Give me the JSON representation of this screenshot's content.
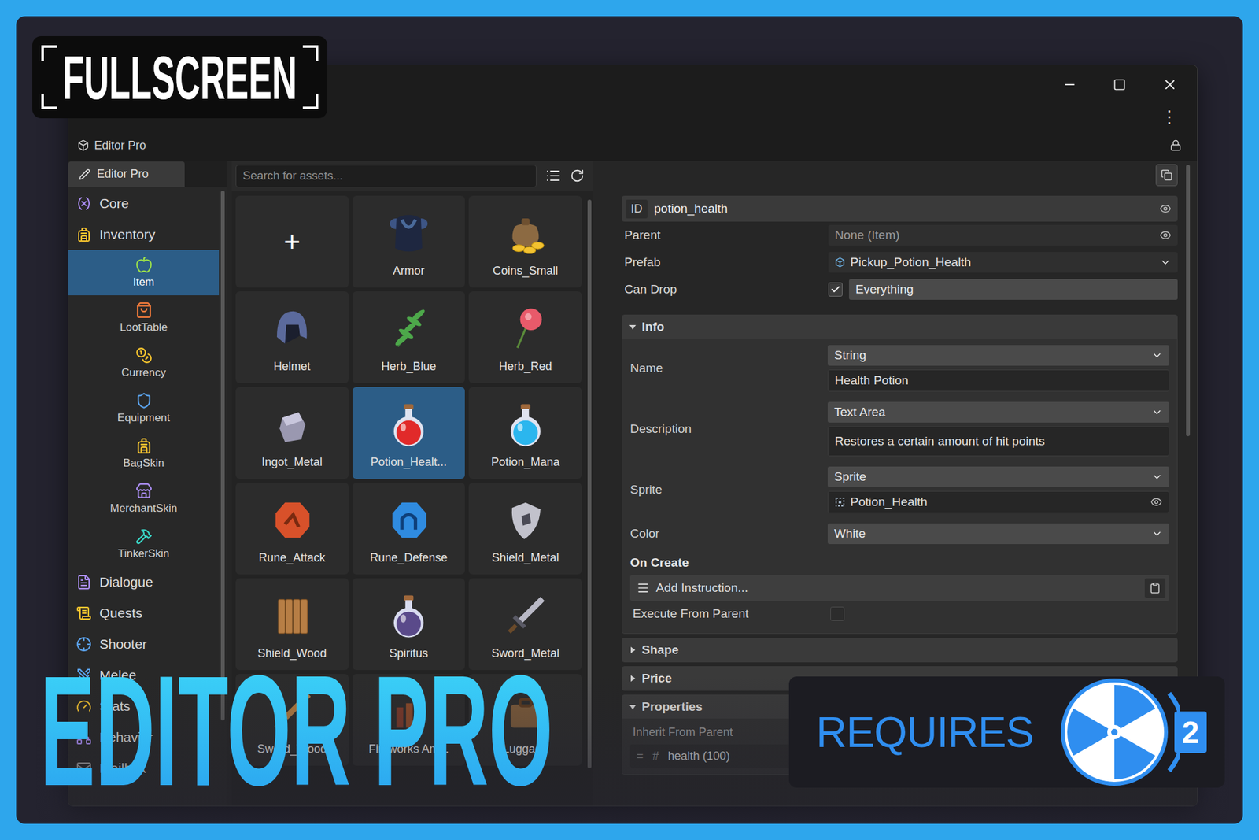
{
  "badge": {
    "text": "FULLSCREEN"
  },
  "window": {
    "title": "Editor Pro",
    "tab": "Editor Pro",
    "more": "⋮"
  },
  "sidebar": {
    "items": [
      {
        "label": "Core",
        "expanded": false,
        "children": []
      },
      {
        "label": "Inventory",
        "expanded": true,
        "children": [
          {
            "label": "Item",
            "selected": true
          },
          {
            "label": "LootTable",
            "selected": false
          },
          {
            "label": "Currency",
            "selected": false
          },
          {
            "label": "Equipment",
            "selected": false
          },
          {
            "label": "BagSkin",
            "selected": false
          },
          {
            "label": "MerchantSkin",
            "selected": false
          },
          {
            "label": "TinkerSkin",
            "selected": false
          }
        ]
      },
      {
        "label": "Dialogue",
        "expanded": false,
        "children": []
      },
      {
        "label": "Quests",
        "expanded": false,
        "children": []
      },
      {
        "label": "Shooter",
        "expanded": false,
        "children": []
      },
      {
        "label": "Melee",
        "expanded": false,
        "children": []
      },
      {
        "label": "Stats",
        "expanded": false,
        "children": []
      },
      {
        "label": "Behavior",
        "expanded": false,
        "children": []
      },
      {
        "label": "Mailbox",
        "expanded": false,
        "children": []
      }
    ]
  },
  "assets": {
    "search_placeholder": "Search for assets...",
    "add": "+",
    "items": [
      {
        "label": "Armor",
        "selected": false
      },
      {
        "label": "Coins_Small",
        "selected": false
      },
      {
        "label": "Helmet",
        "selected": false
      },
      {
        "label": "Herb_Blue",
        "selected": false
      },
      {
        "label": "Herb_Red",
        "selected": false
      },
      {
        "label": "Ingot_Metal",
        "selected": false
      },
      {
        "label": "Potion_Healt...",
        "selected": true
      },
      {
        "label": "Potion_Mana",
        "selected": false
      },
      {
        "label": "Rune_Attack",
        "selected": false
      },
      {
        "label": "Rune_Defense",
        "selected": false
      },
      {
        "label": "Shield_Metal",
        "selected": false
      },
      {
        "label": "Shield_Wood",
        "selected": false
      },
      {
        "label": "Spiritus",
        "selected": false
      },
      {
        "label": "Sword_Metal",
        "selected": false
      },
      {
        "label": "Sword_Wood",
        "selected": false
      },
      {
        "label": "Fireworks Am...",
        "selected": false
      },
      {
        "label": "Luggage",
        "selected": false
      }
    ]
  },
  "inspector": {
    "id": {
      "label": "ID",
      "value": "potion_health"
    },
    "parent": {
      "label": "Parent",
      "value": "None (Item)",
      "empty": true
    },
    "prefab": {
      "label": "Prefab",
      "value": "Pickup_Potion_Health",
      "empty": false
    },
    "can_drop": {
      "label": "Can Drop",
      "checked": true,
      "value": "Everything"
    },
    "info": {
      "label": "Info",
      "expanded": true,
      "rows": [
        {
          "label": "Name",
          "kind": "text",
          "type": "String",
          "value": "Health Potion"
        },
        {
          "label": "Description",
          "kind": "area",
          "type": "Text Area",
          "value": "Restores a certain amount of hit points"
        },
        {
          "label": "Sprite",
          "kind": "object",
          "type": "Sprite",
          "value": "Potion_Health"
        },
        {
          "label": "Color",
          "kind": "choice",
          "type": "White"
        }
      ],
      "on_create": {
        "label": "On Create",
        "button": "Add Instruction...",
        "execute": {
          "label": "Execute From Parent",
          "checked": false
        }
      }
    },
    "sections": [
      {
        "label": "Shape",
        "expanded": false
      },
      {
        "label": "Price",
        "expanded": false
      },
      {
        "label": "Properties",
        "expanded": true,
        "inherit": "Inherit From Parent",
        "rows": [
          {
            "handle": "=",
            "hash": "#",
            "label": "health (100)"
          }
        ]
      }
    ]
  },
  "title": "EDITOR PRO",
  "requires": {
    "text": "REQUIRES",
    "version": "2"
  }
}
